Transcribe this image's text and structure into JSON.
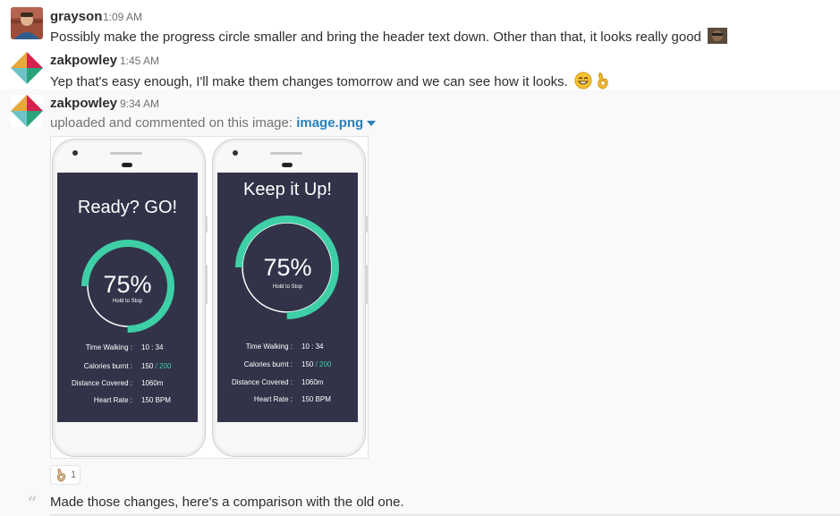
{
  "messages": [
    {
      "user": "grayson",
      "time": "1:09 AM",
      "text": "Possibly make the progress circle smaller and bring the header text down. Other than that, it looks really good"
    },
    {
      "user": "zakpowley",
      "time": "1:45 AM",
      "text": "Yep that's easy enough, I'll make them changes tomorrow and we can see how it looks."
    },
    {
      "user": "zakpowley",
      "time": "9:34 AM",
      "upload_text": "uploaded and commented on this image:",
      "file_name": "image.png"
    }
  ],
  "attachment": {
    "phones": [
      {
        "title": "Ready? GO!",
        "percent": "75%",
        "progress": 0.75,
        "hold": "Hold to Stop",
        "stats": [
          {
            "label": "Time Walking :",
            "value": "10 : 34",
            "goal": ""
          },
          {
            "label": "Calories burnt :",
            "value": "150",
            "goal": "/ 200"
          },
          {
            "label": "Distance Covered :",
            "value": "1060m",
            "goal": ""
          },
          {
            "label": "Heart Rate :",
            "value": "150 BPM",
            "goal": ""
          }
        ]
      },
      {
        "title": "Keep it Up!",
        "percent": "75%",
        "progress": 0.75,
        "hold": "Hold to Stop",
        "stats": [
          {
            "label": "Time Walking :",
            "value": "10 : 34",
            "goal": ""
          },
          {
            "label": "Calories burnt :",
            "value": "150",
            "goal": "/ 200"
          },
          {
            "label": "Distance Covered :",
            "value": "1060m",
            "goal": ""
          },
          {
            "label": "Heart Rate :",
            "value": "150 BPM",
            "goal": ""
          }
        ]
      }
    ]
  },
  "reaction": {
    "emoji": "ok-hand-emoji",
    "count": "1"
  },
  "comment": {
    "text": "Made those changes, here's a comparison with the old one."
  },
  "colors": {
    "screen_bg": "#323349",
    "progress_teal": "#3ecfa6",
    "link_blue": "#2a80b9"
  },
  "icons": [
    "smile-emoji",
    "ok-hand-emoji",
    "file-dropdown-icon",
    "quote-icon"
  ]
}
